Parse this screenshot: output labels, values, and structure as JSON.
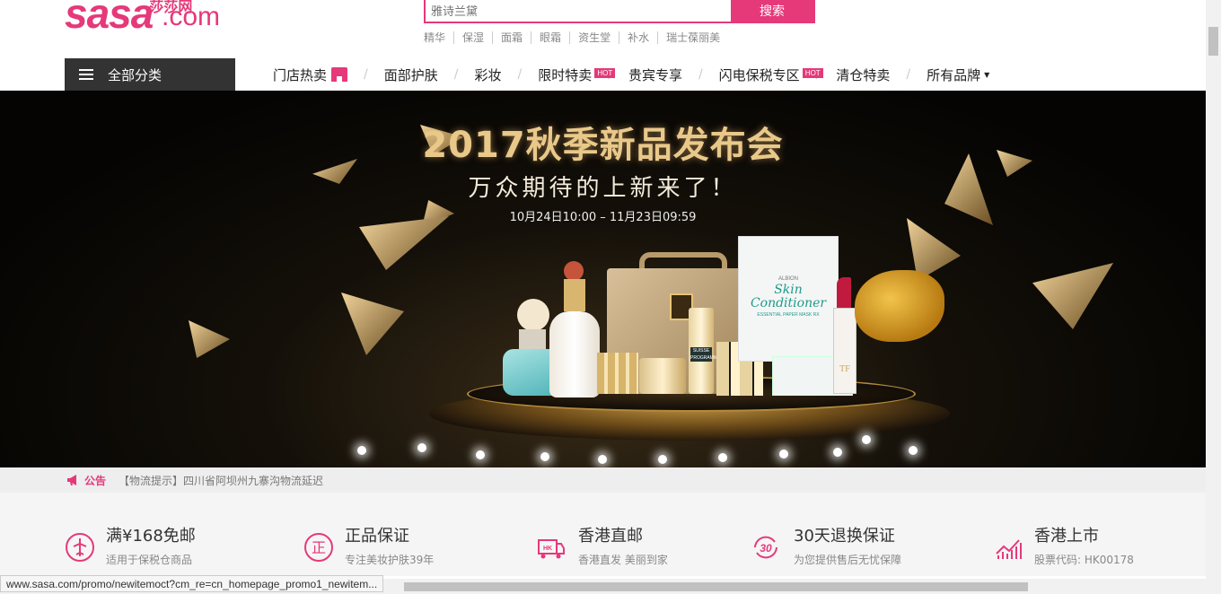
{
  "logo": {
    "brand": "sasa",
    "cn": "莎莎网",
    "dotcom": ".com"
  },
  "search": {
    "placeholder": "雅诗兰黛",
    "button": "搜索"
  },
  "hotwords": [
    "精华",
    "保湿",
    "面霜",
    "眼霜",
    "资生堂",
    "补水",
    "瑞士葆丽美"
  ],
  "nav": {
    "all_categories": "全部分类",
    "items": [
      "门店热卖",
      "面部护肤",
      "彩妆",
      "限时特卖",
      "贵宾专享",
      "闪电保税专区",
      "清仓特卖",
      "所有品牌"
    ],
    "hot_badge": "HOT"
  },
  "banner": {
    "title": "2017秋季新品发布会",
    "subtitle": "万众期待的上新来了！",
    "date": "10月24日10:00 – 11月23日09:59",
    "mask_brand": "ALBION",
    "mask_name": "Skin Conditioner",
    "mask_desc": "ESSENTIAL PAPER MASK RX",
    "suisse": "SUISSE PROGRAMME",
    "tf": "TF"
  },
  "notice": {
    "label": "公告",
    "text": "【物流提示】四川省阿坝州九寨沟物流延迟"
  },
  "features": [
    {
      "title": "满¥168免邮",
      "desc": "适用于保税仓商品",
      "icon": "plane-icon"
    },
    {
      "title": "正品保证",
      "desc": "专注美妆护肤39年",
      "icon": "genuine-icon"
    },
    {
      "title": "香港直邮",
      "desc": "香港直发 美丽到家",
      "icon": "truck-icon"
    },
    {
      "title": "30天退换保证",
      "desc": "为您提供售后无忧保障",
      "icon": "return-30-icon"
    },
    {
      "title": "香港上市",
      "desc": "股票代码: HK00178",
      "icon": "stock-chart-icon"
    }
  ],
  "status_url": "www.sasa.com/promo/newitemoct?cm_re=cn_homepage_promo1_newitem...",
  "colors": {
    "brand": "#e5397a",
    "nav_dark": "#333333"
  }
}
